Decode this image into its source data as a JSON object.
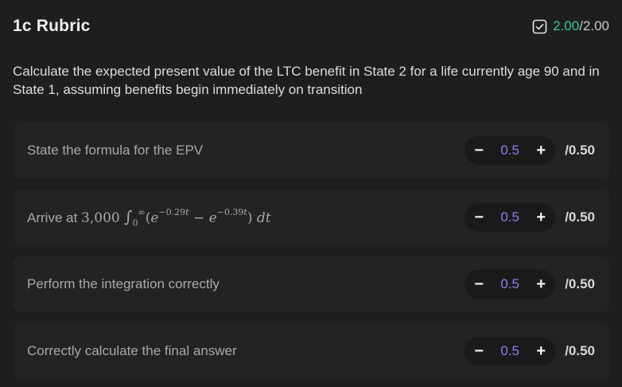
{
  "header": {
    "title": "1c Rubric",
    "score_earned": "2.00",
    "score_total": "/2.00"
  },
  "question": "Calculate the expected present value of the LTC benefit in State 2 for a life currently age 90 and in State 1, assuming benefits begin immediately on transition",
  "criteria": [
    {
      "label": "State the formula for the EPV",
      "value": "0.5",
      "max": "/0.50"
    },
    {
      "label_prefix": "Arrive at",
      "label_number": "3,000",
      "label_formula": "∫₀^∞ (e^{−0.29t} − e^{−0.39t}) dt",
      "value": "0.5",
      "max": "/0.50"
    },
    {
      "label": "Perform the integration correctly",
      "value": "0.5",
      "max": "/0.50"
    },
    {
      "label": "Correctly calculate the final answer",
      "value": "0.5",
      "max": "/0.50"
    }
  ],
  "stepper": {
    "minus": "−",
    "plus": "+"
  },
  "icons": {
    "score_check": "checkbox-check-icon"
  },
  "colors": {
    "earned": "#36c98e",
    "value": "#8a7ff0"
  }
}
